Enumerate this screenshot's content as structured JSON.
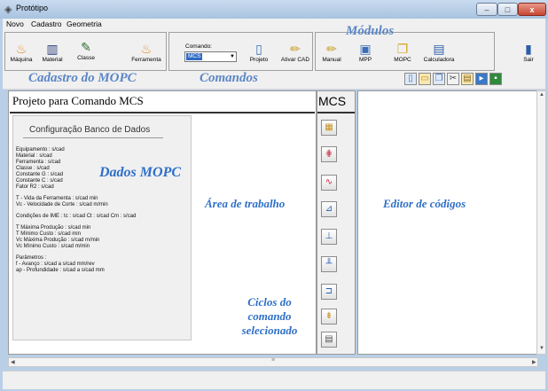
{
  "window": {
    "title": "Protótipo",
    "minimize": "–",
    "maximize": "□",
    "close": "x"
  },
  "menu": [
    "Novo",
    "Cadastro",
    "Geometria"
  ],
  "toolbar": {
    "cadastro": [
      {
        "label": "Máquina",
        "icon": "machine-icon"
      },
      {
        "label": "Material",
        "icon": "material-icon"
      },
      {
        "label": "Classe",
        "icon": "class-icon"
      },
      {
        "label": "Ferramenta",
        "icon": "tool-icon"
      }
    ],
    "comando_label": "Comando:",
    "comando_value": "MCS",
    "comandos": [
      {
        "label": "Projeto",
        "icon": "project-icon"
      },
      {
        "label": "Ativar CAD",
        "icon": "cad-icon"
      }
    ],
    "modulos": [
      {
        "label": "Manual",
        "icon": "manual-icon"
      },
      {
        "label": "MPP",
        "icon": "mpp-icon"
      },
      {
        "label": "MOPC",
        "icon": "mopc-icon"
      },
      {
        "label": "Calculadora",
        "icon": "calculator-icon"
      }
    ],
    "sair": "Sair",
    "group_labels": {
      "cadastro": "Cadastro do MOPC",
      "comandos": "Comandos",
      "modulos": "Módulos"
    }
  },
  "left_panel": {
    "title": "Projeto para Comando MCS",
    "config_title": "Configuração Banco de Dados",
    "lines": [
      "Equipamento : s/cad",
      "Material :      s/cad",
      "Ferramenta :  s/cad",
      "Classe :         s/cad",
      "Constante G :  s/cad",
      "Constante C :  s/cad",
      "Fator R2 :      s/cad",
      "",
      "T - Vida da Ferramenta :   s/cad          min",
      "Vc - Velocidade de Corte : s/cad          m/min",
      "",
      "Condições de IME :   tc : s/cad    Ct : s/cad    Cm : s/cad",
      "",
      "T Máxima Produção :   s/cad           min",
      "T Mínimo Custo :        s/cad           min",
      "Vc Máxima Produção :  s/cad           m/min",
      "Vc Mínimo Custo :        s/cad           m/min",
      "",
      "Parâmetros :",
      "f - Avanço :  s/cad a s/cad                mm/rev",
      "ap - Profundidade :   s/cad a s/cad       mm"
    ],
    "dados_label": "Dados MOPC",
    "area_label": "Área de trabalho",
    "ciclos_label": "Ciclos do comando selecionado"
  },
  "mcs": {
    "label": "MCS"
  },
  "editor": {
    "label": "Editor de códigos"
  }
}
